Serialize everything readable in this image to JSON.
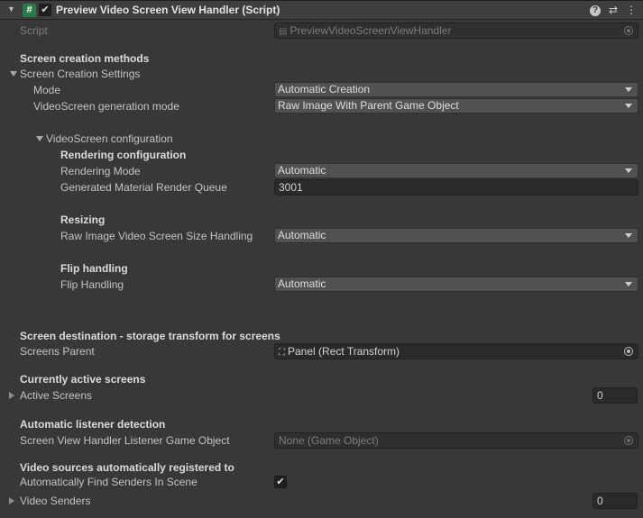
{
  "header": {
    "title": "Preview Video Screen View Handler (Script)",
    "enabled_check": "✔",
    "script_glyph": "#",
    "help_glyph": "?",
    "settings_glyph": "⇄",
    "more_glyph": "⋮"
  },
  "script": {
    "label": "Script",
    "value": "PreviewVideoScreenViewHandler"
  },
  "creation": {
    "heading": "Screen creation methods",
    "foldout": "Screen Creation Settings",
    "mode_label": "Mode",
    "mode_value": "Automatic Creation",
    "gen_label": "VideoScreen generation mode",
    "gen_value": "Raw Image With Parent Game Object"
  },
  "videoscreen": {
    "foldout": "VideoScreen configuration",
    "rendering_heading": "Rendering configuration",
    "rendering_mode_label": "Rendering Mode",
    "rendering_mode_value": "Automatic",
    "queue_label": "Generated Material Render Queue",
    "queue_value": "3001",
    "resizing_heading": "Resizing",
    "size_label": "Raw Image Video Screen Size Handling",
    "size_value": "Automatic",
    "flip_heading": "Flip handling",
    "flip_label": "Flip Handling",
    "flip_value": "Automatic"
  },
  "destination": {
    "heading": "Screen destination - storage transform for screens",
    "parent_label": "Screens Parent",
    "parent_value": "Panel (Rect Transform)"
  },
  "active": {
    "heading": "Currently active screens",
    "label": "Active Screens",
    "count": "0"
  },
  "listener": {
    "heading": "Automatic listener detection",
    "label": "Screen View Handler Listener Game Object",
    "value": "None (Game Object)"
  },
  "sources": {
    "heading": "Video sources automatically registered to",
    "find_label": "Automatically Find Senders In Scene",
    "find_checked": "✔",
    "senders_label": "Video Senders",
    "senders_count": "0"
  },
  "colors": {
    "background": "#383838",
    "header": "#3e3e3e",
    "dropdown": "#515151",
    "field": "#2a2a2a",
    "script_icon": "#2a7a4b"
  },
  "icons": [
    "fold-arrow",
    "script-icon",
    "checkbox",
    "help-icon",
    "preset-icon",
    "more-icon",
    "object-picker-icon",
    "rect-transform-icon",
    "script-asset-icon"
  ]
}
